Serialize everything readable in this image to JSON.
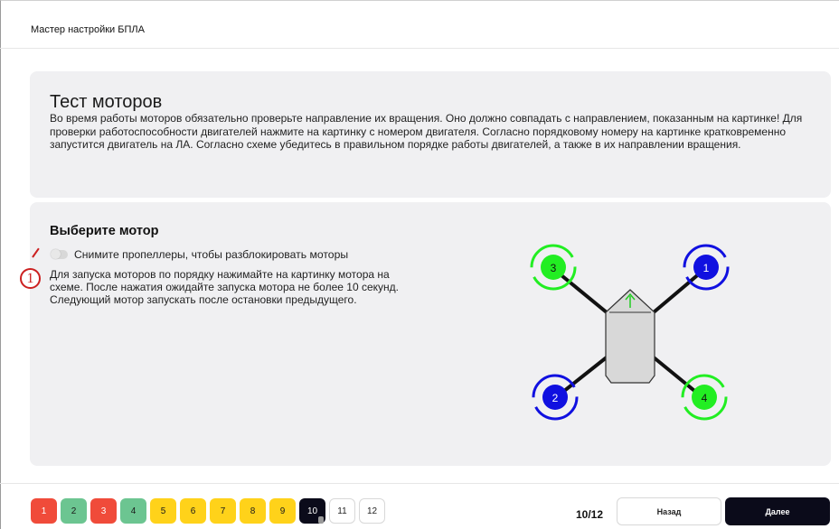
{
  "window": {
    "title": "Мастер настройки БПЛА"
  },
  "motor_test": {
    "title": "Тест моторов",
    "description": "Во время работы моторов обязательно проверьте направление их вращения. Оно должно совпадать с направлением, показанным на картинке! Для проверки работоспособности двигателей нажмите на картинку с номером двигателя. Согласно порядковому номеру на картинке кратковременно запустится двигатель на ЛА. Согласно схеме убедитесь в правильном порядке работы двигателей, а также в их направлении вращения."
  },
  "motor_select": {
    "title": "Выберите мотор",
    "toggle_label": "Снимите пропеллеры, чтобы разблокировать моторы",
    "toggle_on": false,
    "instructions": "Для запуска моторов по порядку нажимайте на картинку мотора на схеме. После нажатия ожидайте запуска мотора не более 10 секунд. Следующий мотор запускать после остановки предыдущего.",
    "annotation_marker": "1"
  },
  "diagram": {
    "motors": [
      {
        "label": "1",
        "color": "#1010e0",
        "position": "top-right"
      },
      {
        "label": "2",
        "color": "#1010e0",
        "position": "bottom-left"
      },
      {
        "label": "3",
        "color": "#22ee22",
        "position": "top-left"
      },
      {
        "label": "4",
        "color": "#22ee22",
        "position": "bottom-right"
      }
    ],
    "arrow_color": "#22cc22",
    "body_color": "#d8d8d8"
  },
  "steps": [
    {
      "label": "1",
      "status": "red"
    },
    {
      "label": "2",
      "status": "green"
    },
    {
      "label": "3",
      "status": "red"
    },
    {
      "label": "4",
      "status": "green"
    },
    {
      "label": "5",
      "status": "yellow"
    },
    {
      "label": "6",
      "status": "yellow"
    },
    {
      "label": "7",
      "status": "yellow"
    },
    {
      "label": "8",
      "status": "yellow"
    },
    {
      "label": "9",
      "status": "yellow"
    },
    {
      "label": "10",
      "status": "current"
    },
    {
      "label": "11",
      "status": "pending"
    },
    {
      "label": "12",
      "status": "pending"
    }
  ],
  "footer": {
    "counter": "10/12",
    "back_label": "Назад",
    "next_label": "Далее"
  },
  "colors": {
    "red": "#f04b3a",
    "green": "#6cc591",
    "yellow": "#ffd21a",
    "dark": "#0b0b1a"
  }
}
